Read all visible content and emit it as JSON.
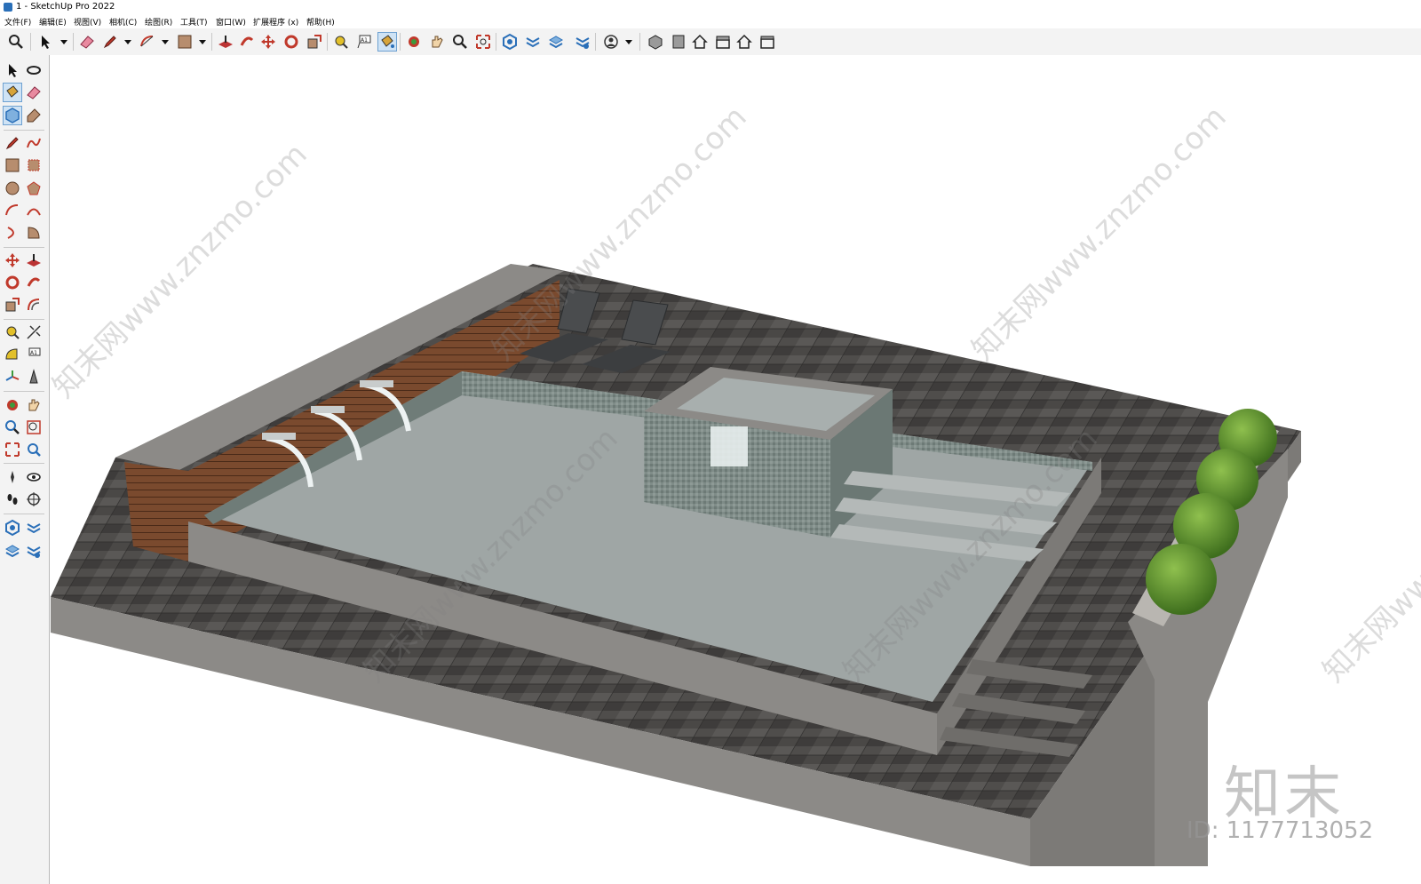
{
  "window": {
    "title": "1 - SketchUp Pro 2022"
  },
  "menu": {
    "items": [
      "文件(F)",
      "编辑(E)",
      "视图(V)",
      "相机(C)",
      "绘图(R)",
      "工具(T)",
      "窗口(W)",
      "扩展程序 (x)",
      "帮助(H)"
    ]
  },
  "toolbar": {
    "icons": [
      "zoom-icon",
      "select-icon",
      "eraser-icon",
      "pencil-icon",
      "arc-icon",
      "rectangle-icon",
      "push-pull-icon",
      "follow-me-icon",
      "move-icon",
      "rotate-icon",
      "scale-icon",
      "tape-measure-icon",
      "text-icon",
      "paint-bucket-icon",
      "orbit-icon",
      "pan-icon",
      "zoom-window-icon",
      "zoom-extents-icon",
      "components-icon",
      "sandbox-icon",
      "layers-icon",
      "styles-icon",
      "account-icon",
      "iso-view-icon",
      "front-view-icon",
      "home-view-icon",
      "top-view-icon",
      "house-view-icon",
      "side-view-icon"
    ]
  },
  "watermark": {
    "site": "知末网www.znzmo.com",
    "logo": "知末",
    "id_text": "ID: 1177713052"
  },
  "colors": {
    "accent": "#2a6fb8",
    "paving": "#4a4846",
    "concrete": "#8c8a87",
    "wood": "#7a4a2e",
    "water": "#9fa6a5",
    "shrub": "#5f9a2f"
  }
}
